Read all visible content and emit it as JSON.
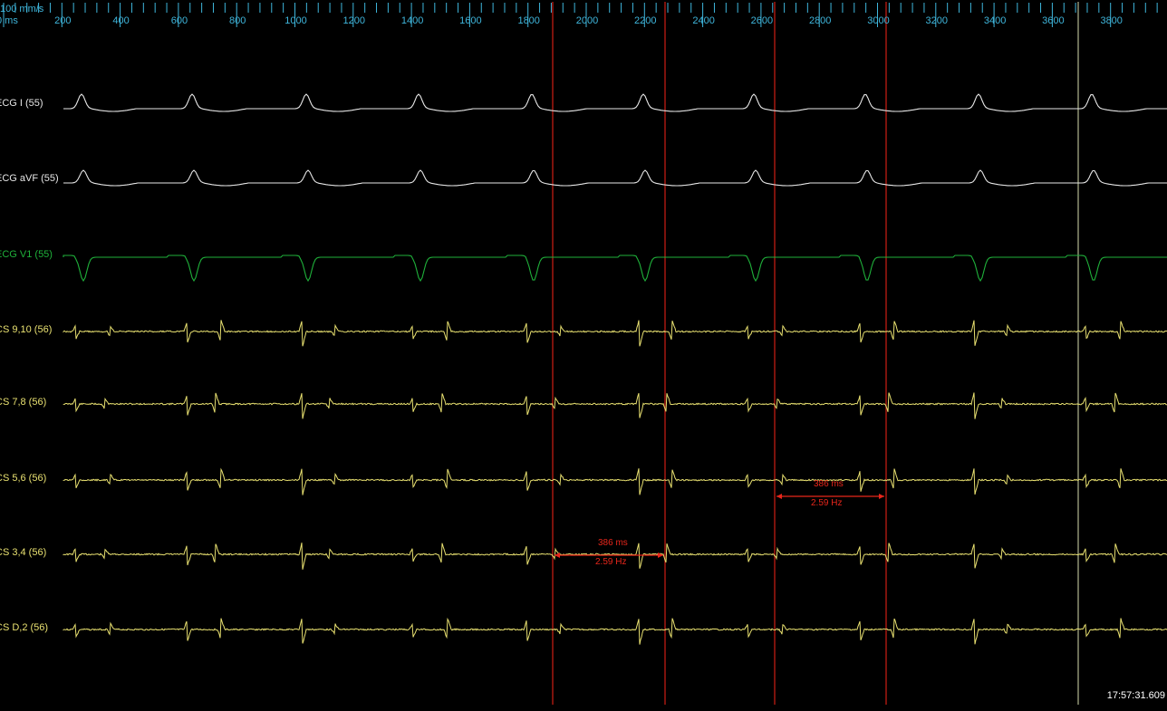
{
  "ruler": {
    "speed": "100 mm/s",
    "unit": "0 ms",
    "ticks": [
      "200",
      "400",
      "600",
      "800",
      "1000",
      "1200",
      "1400",
      "1600",
      "1800",
      "2000",
      "2200",
      "2400",
      "2600",
      "2800",
      "3000",
      "3200",
      "3400",
      "3600",
      "3800",
      "4"
    ]
  },
  "channels": [
    {
      "label": "ECG I (55)",
      "color": "#e6e6e6"
    },
    {
      "label": "ECG aVF (55)",
      "color": "#e6e6e6"
    },
    {
      "label": "ECG V1 (55)",
      "color": "#1fb03a"
    },
    {
      "label": "CS 9,10 (56)",
      "color": "#e8e070"
    },
    {
      "label": "CS 7,8 (56)",
      "color": "#e8e070"
    },
    {
      "label": "CS 5,6 (56)",
      "color": "#e8e070"
    },
    {
      "label": "CS 3,4 (56)",
      "color": "#e8e070"
    },
    {
      "label": "CS D,2 (56)",
      "color": "#e8e070"
    }
  ],
  "measurements": [
    {
      "interval": "386 ms",
      "rate": "2.59 Hz"
    },
    {
      "interval": "386 ms",
      "rate": "2.59 Hz"
    }
  ],
  "cursor_color": "#b11b12",
  "marker_color": "#d6dcae",
  "timestamp": "17:57:31.609"
}
